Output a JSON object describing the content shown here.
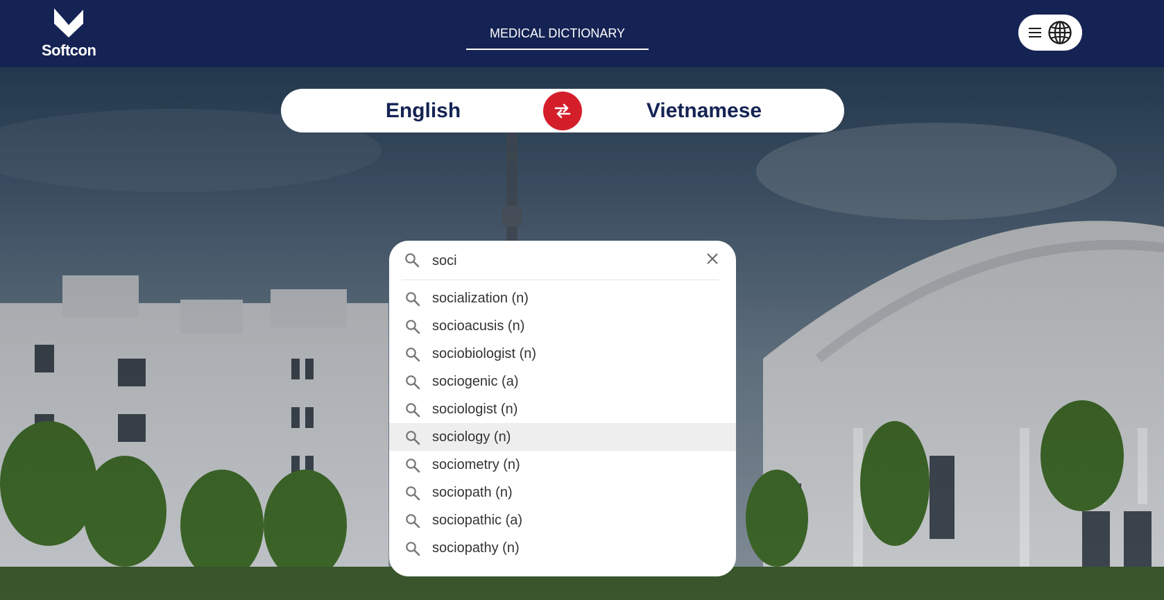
{
  "brand": {
    "name": "Softcon"
  },
  "nav": {
    "title": "MEDICAL DICTIONARY"
  },
  "header_menu": {
    "menu_icon": "hamburger-icon",
    "language_icon": "globe-icon"
  },
  "languages": {
    "source": "English",
    "target": "Vietnamese",
    "swap_icon": "swap-arrows-icon"
  },
  "search": {
    "query": "soci",
    "search_icon": "search-icon",
    "clear_icon": "close-icon",
    "suggestions": [
      {
        "label": "socialization (n)"
      },
      {
        "label": "socioacusis (n)"
      },
      {
        "label": "sociobiologist (n)"
      },
      {
        "label": "sociogenic (a)"
      },
      {
        "label": "sociologist (n)"
      },
      {
        "label": "sociology (n)"
      },
      {
        "label": "sociometry (n)"
      },
      {
        "label": "sociopath (n)"
      },
      {
        "label": "sociopathic (a)"
      },
      {
        "label": "sociopathy (n)"
      }
    ],
    "highlighted_index": 5
  },
  "colors": {
    "header_bg": "#152354",
    "accent_red": "#d41f2b",
    "text_dark": "#152354",
    "highlight_row": "#eeeeee"
  }
}
